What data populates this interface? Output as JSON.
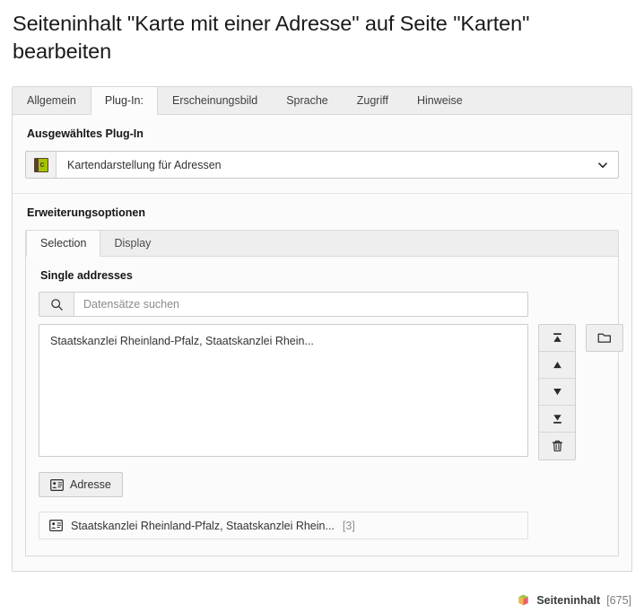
{
  "page": {
    "heading": "Seiteninhalt \"Karte mit einer Adresse\" auf Seite \"Karten\" bearbeiten"
  },
  "outer_tabs": [
    {
      "label": "Allgemein",
      "active": false
    },
    {
      "label": "Plug-In:",
      "active": true
    },
    {
      "label": "Erscheinungsbild",
      "active": false
    },
    {
      "label": "Sprache",
      "active": false
    },
    {
      "label": "Zugriff",
      "active": false
    },
    {
      "label": "Hinweise",
      "active": false
    }
  ],
  "plugin_section": {
    "title": "Ausgewähltes Plug-In",
    "selected_value": "Kartendarstellung für Adressen",
    "icon": "plugin-book-icon",
    "caret_icon": "chevron-down-icon"
  },
  "options_section": {
    "title": "Erweiterungsoptionen",
    "tabs": [
      {
        "label": "Selection",
        "active": true
      },
      {
        "label": "Display",
        "active": false
      }
    ],
    "field_label": "Single addresses",
    "search": {
      "placeholder": "Datensätze suchen",
      "value": "",
      "icon": "search-icon"
    },
    "listbox": {
      "options": [
        "Staatskanzlei Rheinland-Pfalz, Staatskanzlei Rhein..."
      ]
    },
    "side_buttons": [
      {
        "name": "move-to-top-button",
        "icon": "move-to-top-icon"
      },
      {
        "name": "move-up-button",
        "icon": "arrow-up-icon"
      },
      {
        "name": "move-down-button",
        "icon": "arrow-down-icon"
      },
      {
        "name": "move-to-bottom-button",
        "icon": "move-to-bottom-icon"
      },
      {
        "name": "delete-button",
        "icon": "trash-icon"
      }
    ],
    "browse_button": {
      "icon": "folder-icon"
    },
    "create_button": {
      "label": "Adresse",
      "icon": "address-card-icon"
    },
    "record": {
      "label": "Staatskanzlei Rheinland-Pfalz, Staatskanzlei Rhein...",
      "uid": "[3]",
      "icon": "address-card-icon"
    }
  },
  "statusbar": {
    "icon": "content-element-cube-icon",
    "name": "Seiteninhalt",
    "uid": "[675]"
  },
  "colors": {
    "panel_bg": "#fbfbfb",
    "tab_bg": "#eeeeee",
    "border": "#d7d7d7",
    "plugin_green": "#a5c400",
    "plugin_brown": "#59402c"
  }
}
